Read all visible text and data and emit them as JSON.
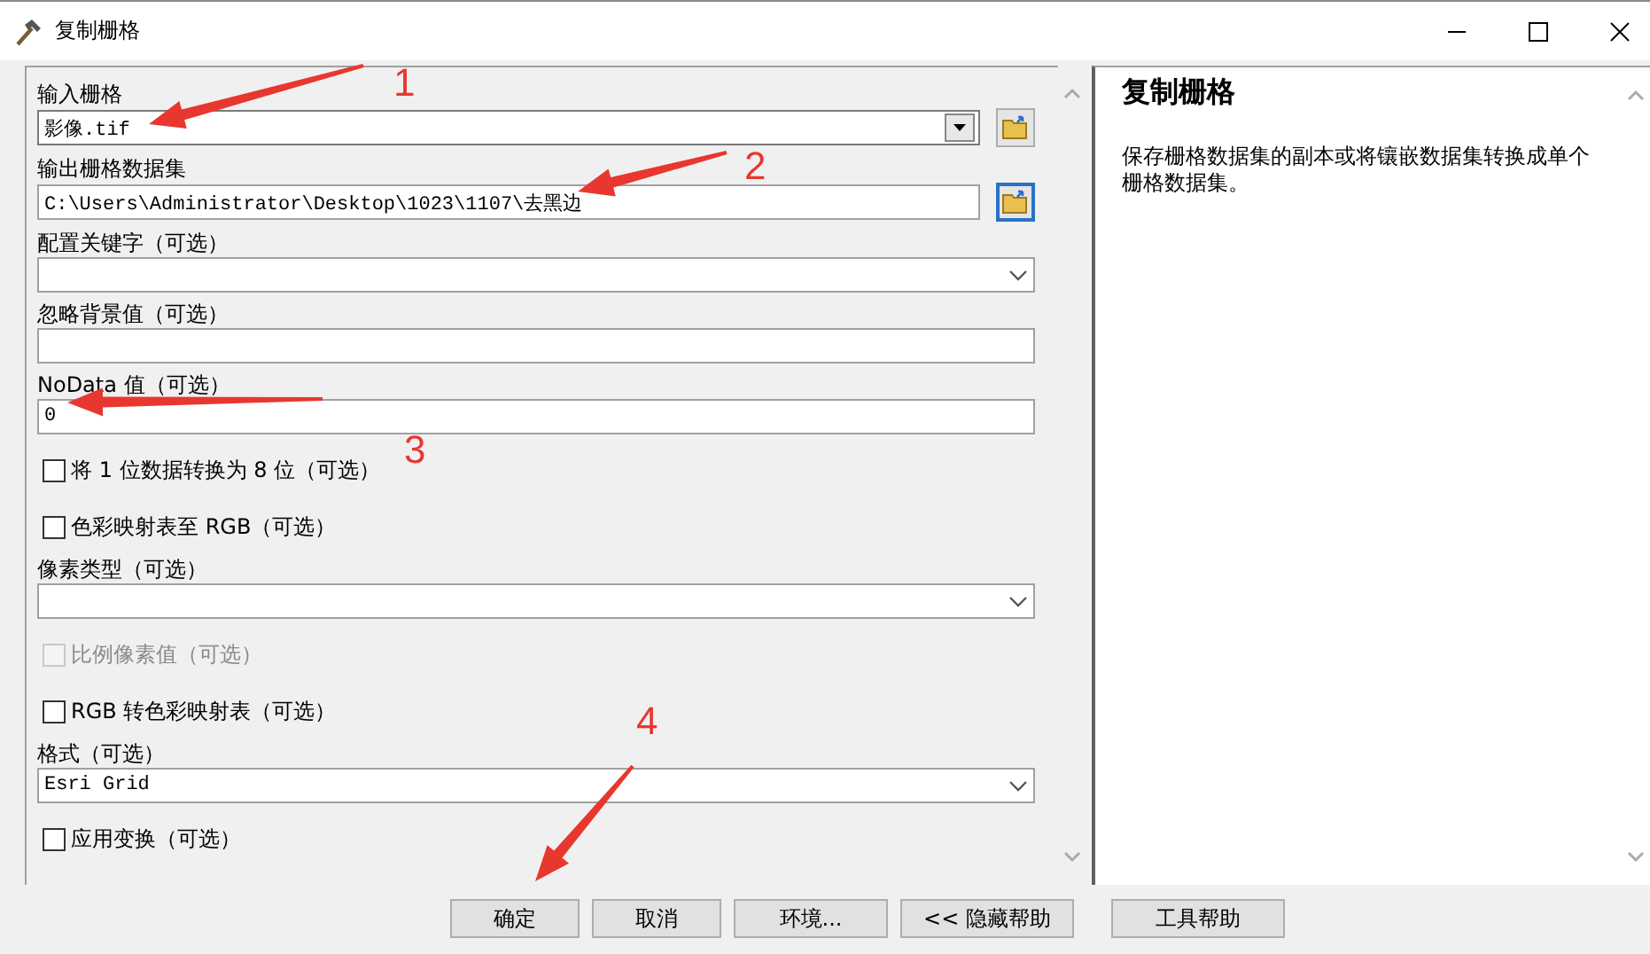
{
  "window": {
    "title": "复制栅格"
  },
  "parameters": [
    {
      "kind": "combo_browse",
      "label": "输入栅格",
      "value": "影像.tif"
    },
    {
      "kind": "text_browse",
      "label": "输出栅格数据集",
      "value": "C:\\Users\\Administrator\\Desktop\\1023\\1107\\去黑边"
    },
    {
      "kind": "dropdown",
      "label": "配置关键字（可选）"
    },
    {
      "kind": "text",
      "label": "忽略背景值（可选）"
    },
    {
      "kind": "text",
      "label": "NoData 值（可选）",
      "value": "0"
    },
    {
      "kind": "checkbox",
      "label": "将 1 位数据转换为 8 位（可选）",
      "checked": false,
      "disabled": false
    },
    {
      "kind": "checkbox",
      "label": "色彩映射表至 RGB（可选）",
      "checked": false,
      "disabled": false
    },
    {
      "kind": "dropdown",
      "label": "像素类型（可选）"
    },
    {
      "kind": "checkbox",
      "label": "比例像素值（可选）",
      "checked": false,
      "disabled": true
    },
    {
      "kind": "checkbox",
      "label": "RGB 转色彩映射表（可选）",
      "checked": false,
      "disabled": false
    },
    {
      "kind": "dropdown",
      "label": "格式（可选）",
      "value": "Esri Grid"
    },
    {
      "kind": "checkbox",
      "label": "应用变换（可选）",
      "checked": false,
      "disabled": false
    }
  ],
  "help": {
    "title": "复制栅格",
    "text": "保存栅格数据集的副本或将镶嵌数据集转换成单个栅格数据集。"
  },
  "buttons": [
    "确定",
    "取消",
    "环境...",
    "<< 隐藏帮助",
    "工具帮助"
  ],
  "annotations": [
    "1",
    "2",
    "3",
    "4"
  ]
}
